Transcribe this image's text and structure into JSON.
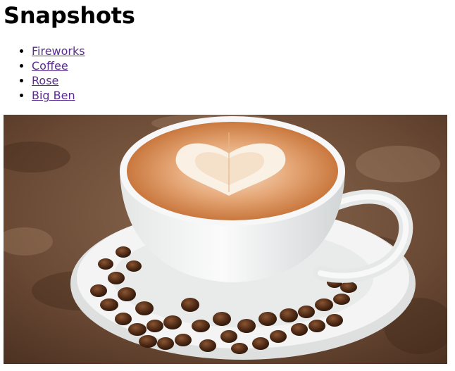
{
  "page": {
    "title": "Snapshots"
  },
  "nav": {
    "links": [
      {
        "label": "Fireworks"
      },
      {
        "label": "Coffee"
      },
      {
        "label": "Rose"
      },
      {
        "label": "Big Ben"
      }
    ],
    "link_color": "#5b2c8f"
  },
  "image": {
    "subject": "coffee-latte-photo"
  }
}
